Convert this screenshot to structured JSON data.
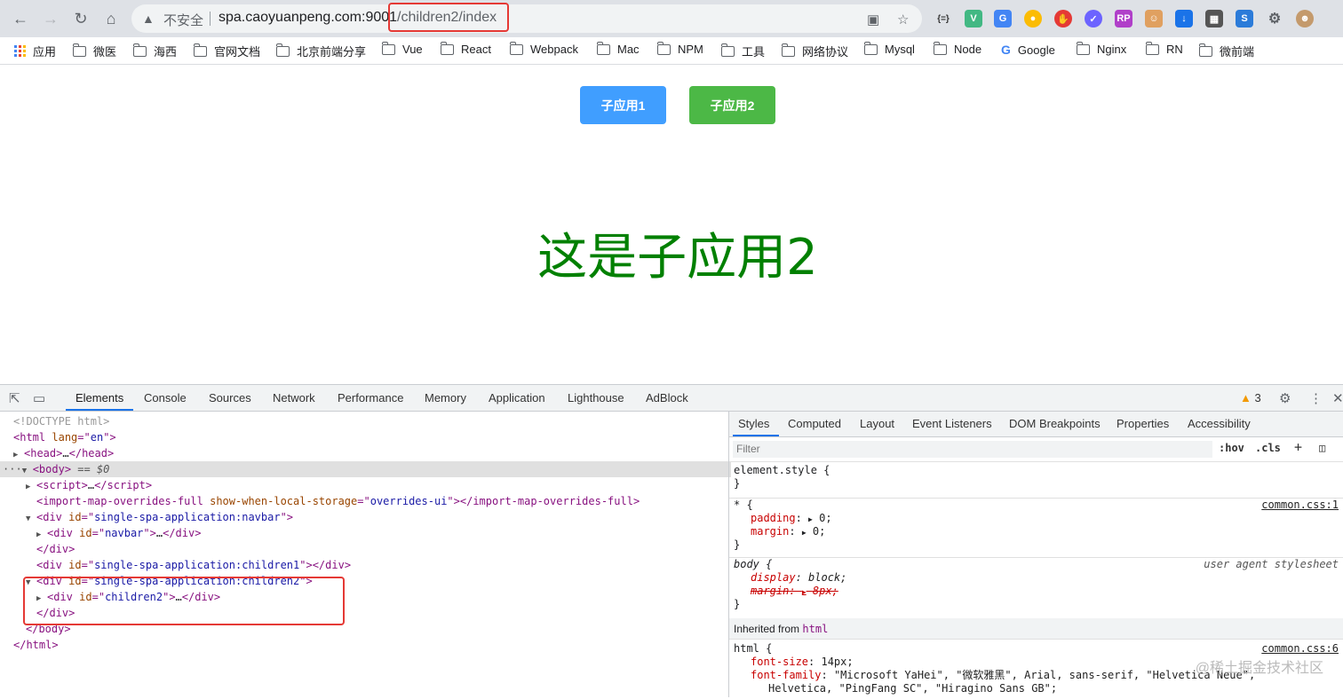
{
  "browser": {
    "insecure_label": "不安全",
    "url_host": "spa.caoyuanpeng.com:9001",
    "url_path": "/children2/index",
    "bookmarks": [
      "应用",
      "微医",
      "海西",
      "官网文档",
      "北京前端分享",
      "Vue",
      "React",
      "Webpack",
      "Mac",
      "NPM",
      "工具",
      "网络协议",
      "Mysql",
      "Node",
      "Google",
      "Nginx",
      "RN",
      "微前端"
    ]
  },
  "page": {
    "btn1": "子应用1",
    "btn2": "子应用2",
    "title": "这是子应用2",
    "accent_blue": "#409eff",
    "accent_green": "#4cb846",
    "title_color": "#008000"
  },
  "devtools": {
    "tabs": [
      "Elements",
      "Console",
      "Sources",
      "Network",
      "Performance",
      "Memory",
      "Application",
      "Lighthouse",
      "AdBlock"
    ],
    "warning_count": "3",
    "dom": {
      "doctype": "<!DOCTYPE html>",
      "html_open_tag": "html",
      "html_lang_attr": "lang",
      "html_lang_val": "en",
      "head_text": "head",
      "head_ellipsis": "…",
      "body_tag": "body",
      "body_eq": " == $0",
      "script_tag": "script",
      "imo_tag": "import-map-overrides-full",
      "imo_attr": "show-when-local-storage",
      "imo_val": "overrides-ui",
      "div_tag": "div",
      "id_attr": "id",
      "navbar_app_id": "single-spa-application:navbar",
      "navbar_id": "navbar",
      "children1_app_id": "single-spa-application:children1",
      "children2_app_id": "single-spa-application:children2",
      "children2_id": "children2",
      "close_div": "</div>",
      "close_body": "</body>",
      "close_html": "</html>"
    },
    "styles": {
      "tabs": [
        "Styles",
        "Computed",
        "Layout",
        "Event Listeners",
        "DOM Breakpoints",
        "Properties",
        "Accessibility"
      ],
      "filter_placeholder": "Filter",
      "hov": ":hov",
      "cls": ".cls",
      "element_style": "element.style {",
      "close_brace": "}",
      "star_selector": "* {",
      "common_css_1": "common.css:1",
      "padding": "padding",
      "margin": "margin",
      "zero": "0;",
      "body_selector": "body {",
      "ua_stylesheet": "user agent stylesheet",
      "display": "display",
      "block": "block;",
      "margin_8": "8px;",
      "inherited_from": "Inherited from",
      "inherited_tag": "html",
      "html_selector": "html {",
      "common_css_6": "common.css:6",
      "font_size": "font-size",
      "font_size_val": "14px;",
      "font_family": "font-family",
      "font_family_val": "\"Microsoft YaHei\", \"微软雅黑\", Arial, sans-serif, \"Helvetica Neue\",",
      "font_family_val2": "Helvetica, \"PingFang SC\", \"Hiragino Sans GB\";"
    }
  },
  "watermark": "@稀土掘金技术社区"
}
